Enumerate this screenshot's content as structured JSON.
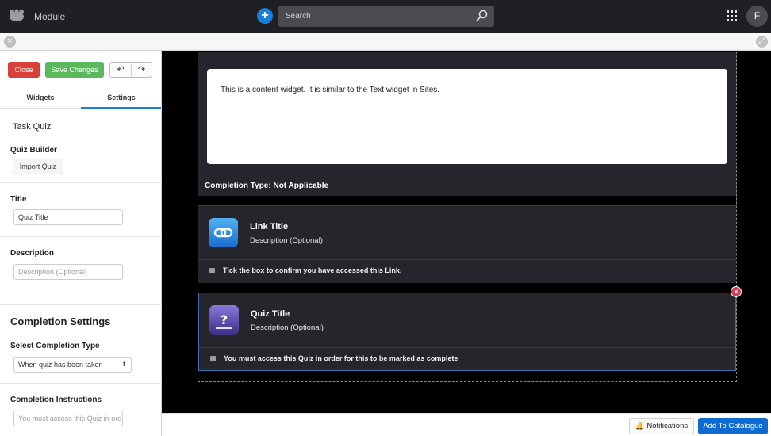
{
  "header": {
    "app_title": "Module",
    "search_placeholder": "Search",
    "avatar_initial": "F",
    "add_label": "+"
  },
  "toolbar": {
    "close_label": "Close",
    "save_label": "Save Changes",
    "undo_icon": "undo-icon",
    "redo_icon": "redo-icon"
  },
  "tabs": [
    {
      "label": "Widgets",
      "active": false
    },
    {
      "label": "Settings",
      "active": true
    }
  ],
  "settings": {
    "widget_name": "Task Quiz",
    "quiz_builder_label": "Quiz Builder",
    "import_label": "Import Quiz",
    "title_label": "Title",
    "title_value": "Quiz Title",
    "description_label": "Description",
    "description_placeholder": "Description (Optional)",
    "completion_heading": "Completion Settings",
    "completion_type_label": "Select Completion Type",
    "completion_type_value": "When quiz has been taken",
    "instructions_label": "Completion Instructions",
    "instructions_value": "You must access this Quiz in ord"
  },
  "canvas": {
    "content_text": "This is a content widget. It is similar to the Text widget in Sites.",
    "completion_type_text": "Completion Type: Not Applicable",
    "link_card": {
      "title": "Link Title",
      "description": "Description (Optional)",
      "note": "Tick the box to confirm you have accessed this Link.",
      "icon": "link-icon"
    },
    "quiz_card": {
      "title": "Quiz Title",
      "description": "Description (Optional)",
      "note": "You must access this Quiz in order for this to be marked as complete",
      "icon": "quiz-icon"
    }
  },
  "footer": {
    "notifications_label": "Notifications",
    "catalogue_label": "Add To Catalogue"
  },
  "colors": {
    "accent": "#1a7fd6",
    "close": "#d9403a",
    "save": "#5cb85c",
    "catalogue": "#0e6bd1"
  }
}
